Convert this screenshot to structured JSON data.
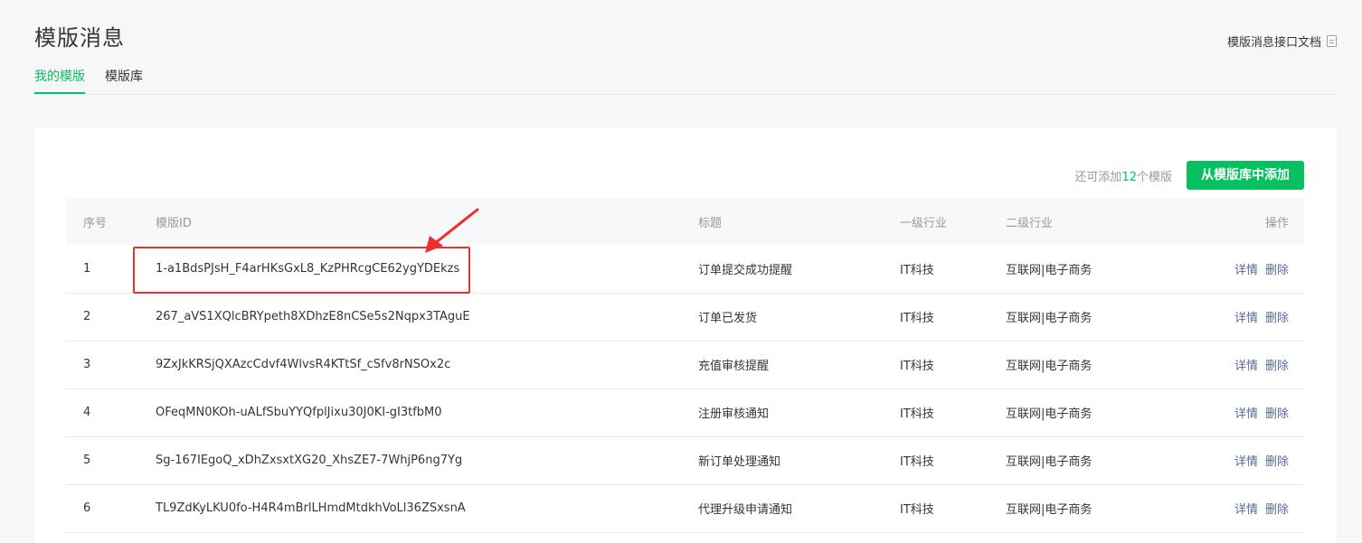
{
  "header": {
    "title": "模版消息",
    "doc_link": "模版消息接口文档",
    "doc_icon": "document-icon"
  },
  "tabs": [
    {
      "label": "我的模版",
      "active": true
    },
    {
      "label": "模版库",
      "active": false
    }
  ],
  "toolbar": {
    "quota_prefix": "还可添加",
    "quota_count": "12",
    "quota_suffix": "个模版",
    "add_button": "从模版库中添加"
  },
  "table": {
    "columns": [
      "序号",
      "模版ID",
      "标题",
      "一级行业",
      "二级行业",
      "操作"
    ],
    "rows": [
      {
        "idx": "1",
        "id": "1-a1BdsPJsH_F4arHKsGxL8_KzPHRcgCE62ygYDEkzs",
        "title": "订单提交成功提醒",
        "industry1": "IT科技",
        "industry2": "互联网|电子商务",
        "detail": "详情",
        "delete": "删除"
      },
      {
        "idx": "2",
        "id": "267_aVS1XQlcBRYpeth8XDhzE8nCSe5s2Nqpx3TAguE",
        "title": "订单已发货",
        "industry1": "IT科技",
        "industry2": "互联网|电子商务",
        "detail": "详情",
        "delete": "删除"
      },
      {
        "idx": "3",
        "id": "9ZxJkKRSjQXAzcCdvf4WlvsR4KTtSf_cSfv8rNSOx2c",
        "title": "充值审核提醒",
        "industry1": "IT科技",
        "industry2": "互联网|电子商务",
        "detail": "详情",
        "delete": "删除"
      },
      {
        "idx": "4",
        "id": "OFeqMN0KOh-uALfSbuYYQfplJixu30J0KI-gI3tfbM0",
        "title": "注册审核通知",
        "industry1": "IT科技",
        "industry2": "互联网|电子商务",
        "detail": "详情",
        "delete": "删除"
      },
      {
        "idx": "5",
        "id": "Sg-167IEgoQ_xDhZxsxtXG20_XhsZE7-7WhjP6ng7Yg",
        "title": "新订单处理通知",
        "industry1": "IT科技",
        "industry2": "互联网|电子商务",
        "detail": "详情",
        "delete": "删除"
      },
      {
        "idx": "6",
        "id": "TL9ZdKyLKU0fo-H4R4mBrlLHmdMtdkhVoLl36ZSxsnA",
        "title": "代理升级申请通知",
        "industry1": "IT科技",
        "industry2": "互联网|电子商务",
        "detail": "详情",
        "delete": "删除"
      }
    ]
  },
  "colors": {
    "accent": "#07c160",
    "link": "#576b95",
    "annotation": "#ef2e2e"
  }
}
